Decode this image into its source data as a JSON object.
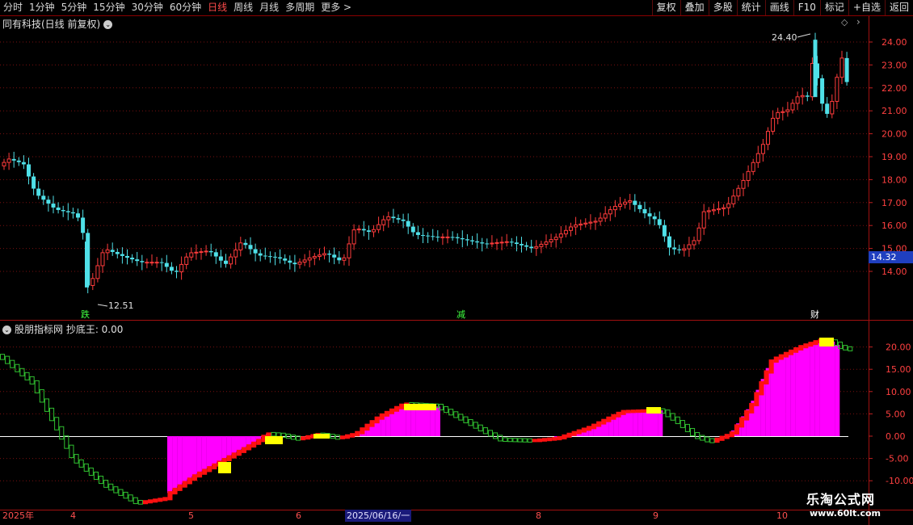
{
  "toolbar": {
    "periods": [
      "分时",
      "1分钟",
      "5分钟",
      "15分钟",
      "30分钟",
      "60分钟",
      "日线",
      "周线",
      "月线",
      "多周期",
      "更多 >"
    ],
    "active_period": "日线",
    "right_buttons": [
      "复权",
      "叠加",
      "多股",
      "统计",
      "画线",
      "F10",
      "标记",
      "+自选",
      "返回"
    ]
  },
  "main_chart": {
    "title": "同有科技(日线 前复权)",
    "price_axis": [
      "24.00",
      "23.00",
      "22.00",
      "21.00",
      "20.00",
      "19.00",
      "18.00",
      "17.00",
      "16.00",
      "15.00",
      "14.00"
    ],
    "current_price": "14.32",
    "high_marker": "24.40",
    "low_marker": "12.51",
    "event_markers": [
      "跌",
      "减",
      "财"
    ],
    "up_color": "#ff3b3b",
    "down_color": "#4fe0e8"
  },
  "sub_chart": {
    "title": "股朋指标网 抄底王: 0.00",
    "axis": [
      "20.00",
      "15.00",
      "10.00",
      "5.00",
      "0.00",
      "-5.00",
      "-10.00"
    ]
  },
  "x_axis": {
    "labels": [
      "2025年",
      "4",
      "5",
      "6",
      "8",
      "9",
      "10"
    ],
    "highlight": "2025/06/16/一"
  },
  "watermark": {
    "line1": "乐淘公式网",
    "line2": "www.60lt.com"
  }
}
